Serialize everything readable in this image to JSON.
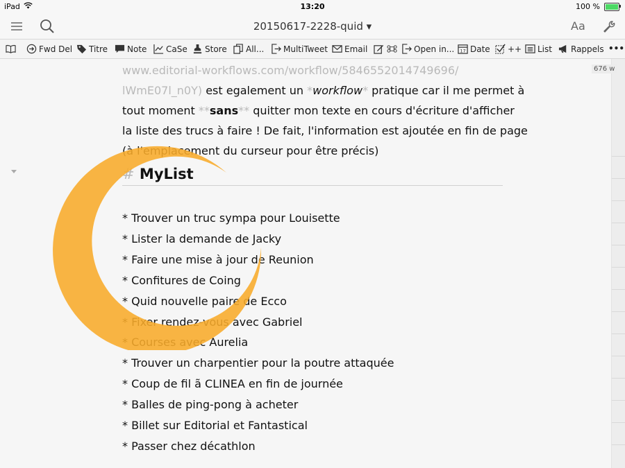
{
  "status": {
    "device": "iPad",
    "time": "13:20",
    "battery": "100 %"
  },
  "nav": {
    "title": "20150617-2228-quid ▾",
    "font_button": "Aa"
  },
  "toolbar": {
    "fwd_del": "Fwd Del",
    "titre": "Titre",
    "note": "Note",
    "case": "CaSe",
    "store": "Store",
    "all": "All...",
    "multitweet": "MultiTweet",
    "email": "Email",
    "open_in": "Open in...",
    "date": "Date",
    "plusplus": "++",
    "list": "List",
    "rappels": "Rappels",
    "more": "•••"
  },
  "editor": {
    "word_count": "676 w",
    "url_line1": "www.editorial-workflows.com/workflow/5846552014749696/",
    "url_line2": "lWmE07l_n0Y)",
    "text_a": " est egalement un ",
    "workflow_open": "*",
    "workflow_word": "workflow",
    "workflow_close": "*",
    "text_b": " pratique car il me permet à",
    "line3_a": "tout moment ",
    "sans_open": "**",
    "sans_word": "sans",
    "sans_close": "**",
    "line3_b": " quitter mon texte en cours d'écriture d'afficher",
    "line4": "la liste des trucs à faire ! De fait, l'information est ajoutée en fin de page",
    "line5": "(à l'emplacement du curseur pour être précis)",
    "heading_hash": "#",
    "heading_text": "MyList",
    "items": [
      "* Trouver un truc sympa pour Louisette",
      "* Lister la demande de Jacky",
      "* Faire une mise à jour de Reunion",
      "* Confitures de Coing",
      "* Quid nouvelle paire de Ecco",
      "* Fixer rendez-vous avec Gabriel",
      "* Courses avec Aurelia",
      "* Trouver un charpentier pour la poutre attaquée",
      "* Coup de fil ã CLINEA en fin de journée",
      "* Balles de ping-pong à acheter",
      "* Billet sur Editorial et Fantastical",
      "* Passer chez décathlon"
    ]
  },
  "colors": {
    "ring": "#f8ab2a",
    "muted": "#b9b9b9",
    "battery": "#4cd964"
  }
}
